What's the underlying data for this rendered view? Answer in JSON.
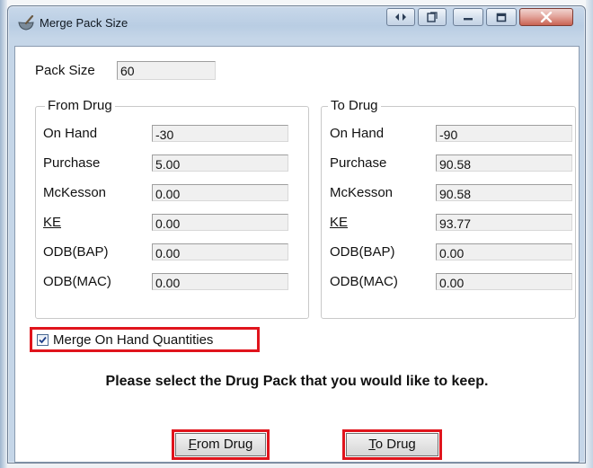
{
  "window": {
    "title": "Merge Pack Size",
    "icons": {
      "app": "mortar-pestle-icon",
      "back": "back-forward-icon",
      "restore": "restore-icon",
      "minimize": "minimize-icon",
      "maximize": "maximize-icon",
      "close": "close-icon"
    }
  },
  "pack_size": {
    "label": "Pack Size",
    "value": "60"
  },
  "from_drug": {
    "title": "From Drug",
    "rows": [
      {
        "label": "On Hand",
        "value": "-30"
      },
      {
        "label": "Purchase",
        "value": "5.00"
      },
      {
        "label": "McKesson",
        "value": "0.00"
      },
      {
        "label": "KE",
        "value": "0.00"
      },
      {
        "label": "ODB(BAP)",
        "value": "0.00"
      },
      {
        "label": "ODB(MAC)",
        "value": "0.00"
      }
    ]
  },
  "to_drug": {
    "title": "To Drug",
    "rows": [
      {
        "label": "On Hand",
        "value": "-90"
      },
      {
        "label": "Purchase",
        "value": "90.58"
      },
      {
        "label": "McKesson",
        "value": "90.58"
      },
      {
        "label": "KE",
        "value": "93.77"
      },
      {
        "label": "ODB(BAP)",
        "value": "0.00"
      },
      {
        "label": "ODB(MAC)",
        "value": "0.00"
      }
    ]
  },
  "merge_checkbox": {
    "label": "Merge On Hand Quantities",
    "checked": true
  },
  "prompt": "Please select the Drug Pack that you would like to keep.",
  "buttons": {
    "from_drug": {
      "accel": "F",
      "rest": "rom Drug"
    },
    "to_drug": {
      "accel": "T",
      "rest": "o Drug"
    }
  },
  "colors": {
    "highlight": "#e0141c",
    "titlebar": "#c8d8ea"
  }
}
